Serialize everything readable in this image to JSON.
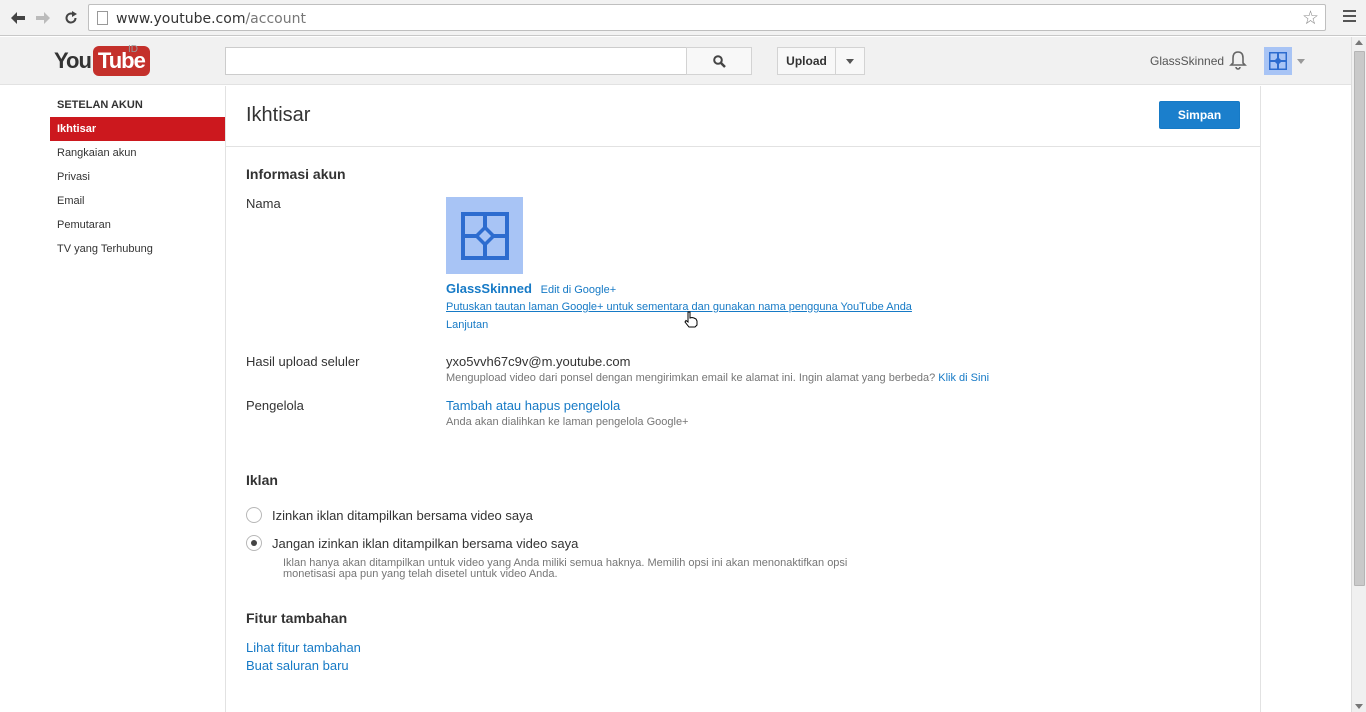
{
  "browser": {
    "url_host": "www.youtube.com",
    "url_path": "/account"
  },
  "header": {
    "logo_you": "You",
    "logo_tube": "Tube",
    "logo_country": "ID",
    "search_placeholder": "",
    "upload_label": "Upload",
    "username": "GlassSkinned"
  },
  "sidebar": {
    "heading": "SETELAN AKUN",
    "items": [
      {
        "label": "Ikhtisar",
        "active": true
      },
      {
        "label": "Rangkaian akun"
      },
      {
        "label": "Privasi"
      },
      {
        "label": "Email"
      },
      {
        "label": "Pemutaran"
      },
      {
        "label": "TV yang Terhubung"
      }
    ]
  },
  "main": {
    "title": "Ikhtisar",
    "save_label": "Simpan",
    "account_info": {
      "heading": "Informasi akun",
      "name_label": "Nama",
      "display_name": "GlassSkinned",
      "edit_link": "Edit di Google+",
      "unlink_link": "Putuskan tautan laman Google+ untuk sementara dan gunakan nama pengguna YouTube Anda",
      "advanced_link": "Lanjutan",
      "mobile_label": "Hasil upload seluler",
      "mobile_email": "yxo5vvh67c9v@m.youtube.com",
      "mobile_note": "Mengupload video dari ponsel dengan mengirimkan email ke alamat ini. Ingin alamat yang berbeda?",
      "mobile_note_link": "Klik di Sini",
      "managers_label": "Pengelola",
      "managers_link": "Tambah atau hapus pengelola",
      "managers_note": "Anda akan dialihkan ke laman pengelola Google+"
    },
    "ads": {
      "heading": "Iklan",
      "option_allow": "Izinkan iklan ditampilkan bersama video saya",
      "option_deny": "Jangan izinkan iklan ditampilkan bersama video saya",
      "selected": "deny",
      "deny_note_line1": "Iklan hanya akan ditampilkan untuk video yang Anda miliki semua haknya. Memilih opsi ini akan menonaktifkan opsi",
      "deny_note_line2": "monetisasi apa pun yang telah disetel untuk video Anda."
    },
    "extra": {
      "heading": "Fitur tambahan",
      "view_link": "Lihat fitur tambahan",
      "create_channel_link": "Buat saluran baru"
    }
  },
  "colors": {
    "accent_red": "#cc181e",
    "link_blue": "#167ac6",
    "button_blue": "#1b7fcc",
    "avatar_blue": "#a8c4f5"
  }
}
